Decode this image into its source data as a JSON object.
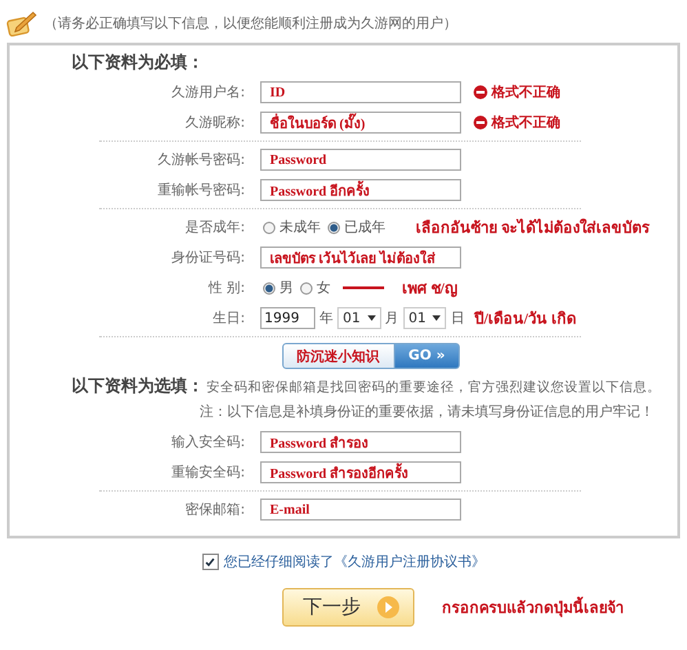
{
  "header": {
    "text": "（请务必正确填写以下信息，以便您能顺利注册成为久游网的用户）"
  },
  "required": {
    "title": "以下资料为必填：",
    "groups": [
      [
        {
          "kind": "text",
          "label": "久游用户名:",
          "value": "ID",
          "error": "格式不正确"
        },
        {
          "kind": "text",
          "label": "久游昵称:",
          "value": "ชื่อในบอร์ด (มั๊ง)",
          "error": "格式不正确"
        }
      ],
      [
        {
          "kind": "text",
          "label": "久游帐号密码:",
          "value": "Password"
        },
        {
          "kind": "text",
          "label": "重输帐号密码:",
          "value": "Password อีกครั้ง"
        }
      ],
      [
        {
          "kind": "radio",
          "label": "是否成年:",
          "options": [
            {
              "label": "未成年",
              "selected": false
            },
            {
              "label": "已成年",
              "selected": true
            }
          ],
          "note": "เลือกอันซ้าย จะได้ไม่ต้องใส่เลขบัตร"
        },
        {
          "kind": "text",
          "label": "身份证号码:",
          "value": "เลขบัตร เว้นไว้เลย ไม่ต้องใส่"
        },
        {
          "kind": "radio",
          "label": "性 别:",
          "options": [
            {
              "label": "男",
              "selected": true
            },
            {
              "label": "女",
              "selected": false
            }
          ],
          "note": "เพศ ช/ญ"
        },
        {
          "kind": "date",
          "label": "生日:",
          "year": "1999",
          "year_unit": "年",
          "month": "01",
          "month_unit": "月",
          "day": "01",
          "day_unit": "日",
          "note": "ปี/เดือน/วัน เกิด"
        }
      ]
    ],
    "tip_button": {
      "label": "防沉迷小知识",
      "go": "GO",
      "arrows": "»"
    }
  },
  "optional": {
    "title": "以下资料为选填：",
    "intro": "安全码和密保邮箱是找回密码的重要途径，官方强烈建议您设置以下信息。",
    "note": "注：以下信息是补填身份证的重要依据，请未填写身份证信息的用户牢记！",
    "groups": [
      [
        {
          "kind": "text",
          "label": "输入安全码:",
          "value": "Password สำรอง"
        },
        {
          "kind": "text",
          "label": "重输安全码:",
          "value": "Password สำรองอีกครั้ง"
        }
      ],
      [
        {
          "kind": "text",
          "label": "密保邮箱:",
          "value": "E-mail"
        }
      ]
    ]
  },
  "agreement": {
    "checked": true,
    "label": "您已经仔细阅读了《久游用户注册协议书》"
  },
  "next_button": {
    "label": "下一步",
    "note": "กรอกครบแล้วกดปุ่มนี้เลยจ้า"
  }
}
